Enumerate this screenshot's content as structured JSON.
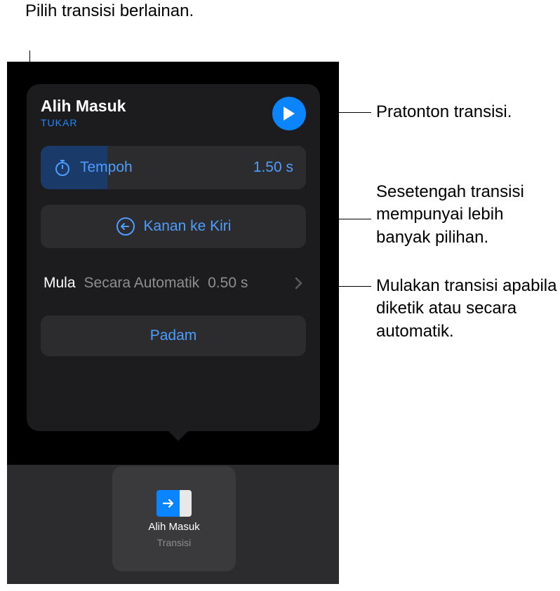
{
  "callouts": {
    "top_left": "Pilih transisi berlainan.",
    "right_1": "Pratonton transisi.",
    "right_2": "Sesetengah transisi mempunyai lebih banyak pilihan.",
    "right_3": "Mulakan transisi apabila diketik atau secara automatik."
  },
  "popover": {
    "title": "Alih Masuk",
    "change": "TUKAR",
    "duration": {
      "label": "Tempoh",
      "value": "1.50 s"
    },
    "direction": {
      "label": "Kanan ke Kiri"
    },
    "start": {
      "key": "Mula",
      "mode": "Secara Automatik",
      "delay": "0.50 s"
    },
    "delete": "Padam"
  },
  "thumb": {
    "title": "Alih Masuk",
    "subtitle": "Transisi"
  }
}
